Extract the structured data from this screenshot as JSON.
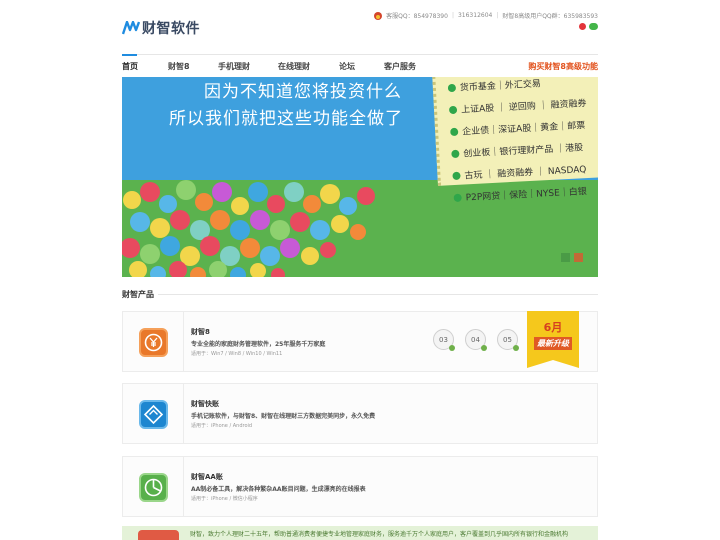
{
  "brand": {
    "logo_text": "财智软件",
    "accent": "#1f8ce0",
    "buy_color": "#e2521d"
  },
  "contact": {
    "qq_label": "客服QQ：854978390",
    "phone": "316312604",
    "vip_qq_group": "财智8高级用户QQ群：635983593"
  },
  "nav": {
    "items": [
      "首页",
      "财智8",
      "手机理财",
      "在线理财",
      "论坛",
      "客户服务"
    ],
    "buy_label": "购买财智8高级功能"
  },
  "banner": {
    "line1": "因为不知道您将投资什么",
    "line2": "所以我们就把这些功能全做了",
    "note_rows": [
      "货币基金｜外汇交易",
      "上证A股 ｜ 逆回购 ｜ 融资融券",
      "企业债｜深证A股｜黄金｜邮票",
      "创业板｜银行理财产品 ｜港股",
      "古玩 ｜ 融资融券 ｜ NASDAQ",
      "P2P网贷｜保险｜NYSE｜白银"
    ]
  },
  "section": {
    "title": "财智产品"
  },
  "products": [
    {
      "name": "财智8",
      "desc": "专业全能的家庭财务管理软件，25年服务千万家庭",
      "systems": "适用于：Win7 / Win8 / Win10 / Win11",
      "months": [
        "03",
        "04",
        "05"
      ],
      "upgrade_month": "6月",
      "upgrade_label": "最新升级"
    },
    {
      "name": "财智快账",
      "desc": "手机记账软件，与财智8、财智在线理财三方数据完美同步，永久免费",
      "systems": "适用于：iPhone / Android"
    },
    {
      "name": "财智AA账",
      "desc": "AA制必备工具，解决各种繁杂AA账目问题，生成漂亮的在线报表",
      "systems": "适用于：iPhone / 微信小程序"
    }
  ],
  "footer": {
    "text": "财智，致力个人理财二十五年，帮助普通消费者便捷专业地管理家庭财务，服务逾千万个人家庭用户，客户覆盖到几乎国内所有银行和金融机构"
  }
}
